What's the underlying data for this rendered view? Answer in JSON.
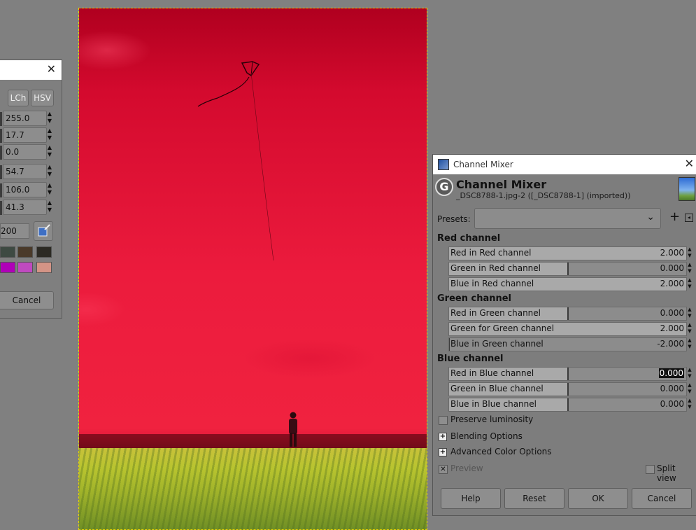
{
  "color_dialog": {
    "mode_buttons": [
      "LCh",
      "HSV"
    ],
    "fields": [
      "255.0",
      "17.7",
      "0.0",
      "54.7",
      "106.0",
      "41.3"
    ],
    "hex_value": "200",
    "history_swatches": [
      "#3e4a42",
      "#4a3a2a",
      "#2c2a24",
      "#b000b8",
      "#c04ac0",
      "#d49486"
    ],
    "cancel_label": "Cancel"
  },
  "mixer": {
    "window_title": "Channel Mixer",
    "title": "Channel Mixer",
    "subtitle": "_DSC8788-1.jpg-2 ([_DSC8788-1] (imported))",
    "presets_label": "Presets:",
    "presets_value": "",
    "sections": {
      "red": {
        "title": "Red channel",
        "rows": [
          {
            "label": "Red in Red channel",
            "value": "2.000",
            "level": 2.0
          },
          {
            "label": "Green in Red channel",
            "value": "0.000",
            "level": 0.0
          },
          {
            "label": "Blue in Red channel",
            "value": "2.000",
            "level": 2.0
          }
        ]
      },
      "green": {
        "title": "Green channel",
        "rows": [
          {
            "label": "Red in Green channel",
            "value": "0.000",
            "level": 0.0
          },
          {
            "label": "Green for Green channel",
            "value": "2.000",
            "level": 2.0
          },
          {
            "label": "Blue in Green channel",
            "value": "-2.000",
            "level": -2.0
          }
        ]
      },
      "blue": {
        "title": "Blue channel",
        "rows": [
          {
            "label": "Red in Blue channel",
            "value": "0.000",
            "level": 0.0
          },
          {
            "label": "Green in Blue channel",
            "value": "0.000",
            "level": 0.0
          },
          {
            "label": "Blue in Blue channel",
            "value": "0.000",
            "level": 0.0
          }
        ]
      }
    },
    "preserve_luminosity": "Preserve luminosity",
    "blending_options": "Blending Options",
    "advanced_color_options": "Advanced Color Options",
    "preview": "Preview",
    "split_view": "Split view",
    "buttons": {
      "help": "Help",
      "reset": "Reset",
      "ok": "OK",
      "cancel": "Cancel"
    }
  }
}
